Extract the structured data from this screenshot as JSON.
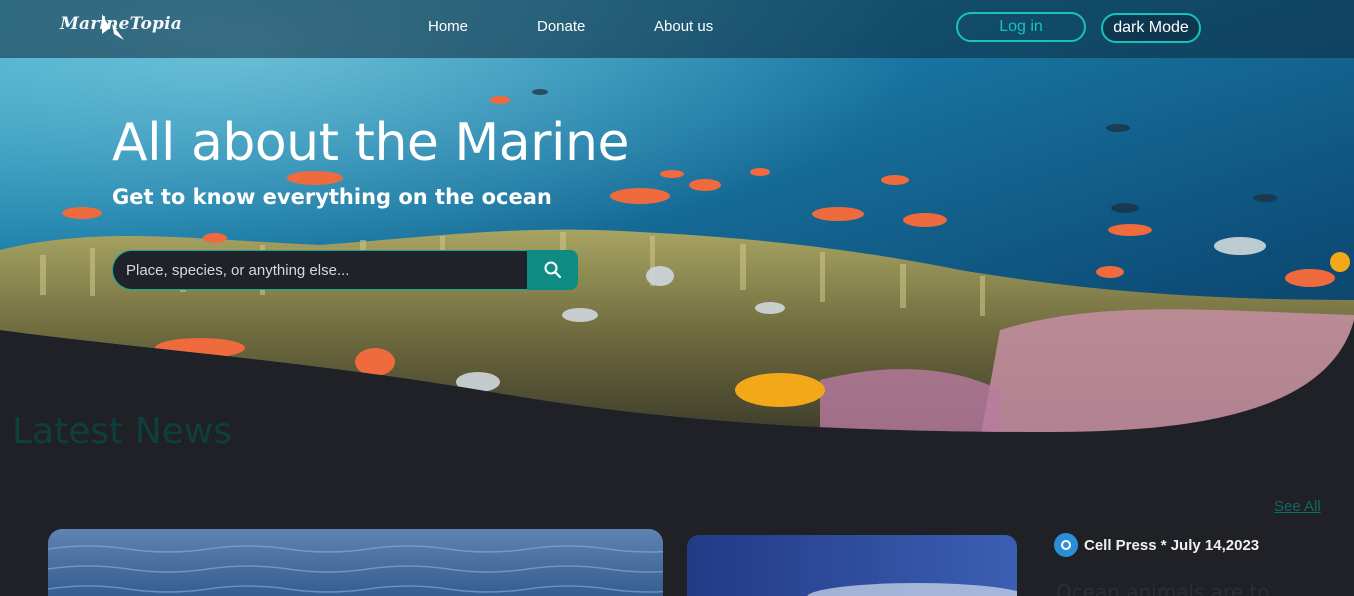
{
  "nav": {
    "logo_text": "MarineTopia",
    "links": [
      "Home",
      "Donate",
      "About us"
    ],
    "login_label": "Log in",
    "dark_mode_label": "dark Mode"
  },
  "hero": {
    "title": "All about the Marine",
    "subtitle": "Get to know everything on the ocean",
    "search_placeholder": "Place, species, or anything else...",
    "search_icon": "search-icon"
  },
  "news": {
    "heading": "Latest News",
    "see_all_label": "See All",
    "source_text": "Cell Press * July 14,2023",
    "article_title": "Ocean animals are to..."
  },
  "colors": {
    "accent": "#17c2bd",
    "search_button": "#0e8c84",
    "page_bg": "#1f2126",
    "heading": "#0d3f3c"
  }
}
